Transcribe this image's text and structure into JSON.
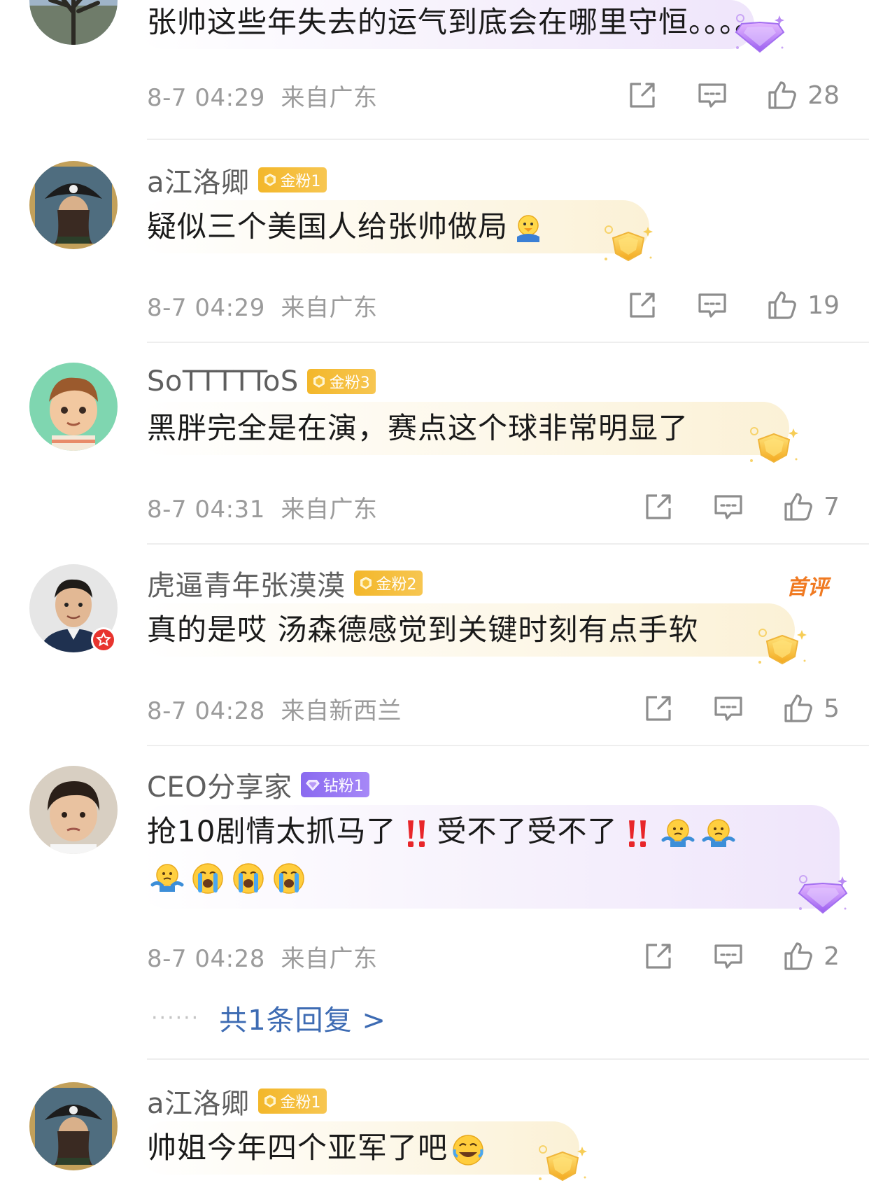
{
  "comments": [
    {
      "username": "",
      "badge": "",
      "lines": [
        "张帅这些年失去的运气到底会在哪里守恒。。。。"
      ],
      "time": "8-7 04:29",
      "location": "来自广东",
      "likes": "28"
    },
    {
      "username": "a江洛卿",
      "badge": "金粉1",
      "lines": [
        "疑似三个美国人给张帅做局"
      ],
      "time": "8-7 04:29",
      "location": "来自广东",
      "likes": "19"
    },
    {
      "username": "SoTTTTToS",
      "badge": "金粉3",
      "lines": [
        "黑胖完全是在演，赛点这个球非常明显了"
      ],
      "time": "8-7 04:31",
      "location": "来自广东",
      "likes": "7"
    },
    {
      "username": "虎逼青年张漠漠",
      "badge": "金粉2",
      "first_comment_tag": "首评",
      "lines": [
        "真的是哎 汤森德感觉到关键时刻有点手软"
      ],
      "time": "8-7 04:28",
      "location": "来自新西兰",
      "likes": "5"
    },
    {
      "username": "CEO分享家",
      "badge": "钻粉1",
      "lines_parts": [
        "抢10剧情太抓马了",
        "受不了受不了"
      ],
      "time": "8-7 04:28",
      "location": "来自广东",
      "likes": "2",
      "replies_label": "共1条回复 >"
    },
    {
      "username": "a江洛卿",
      "badge": "金粉1",
      "lines": [
        "帅姐今年四个亚军了吧"
      ]
    }
  ],
  "icons": {
    "share": "share-icon",
    "reply": "comment-icon",
    "like": "thumbs-up-icon"
  },
  "colors": {
    "gold_badge": "#f3b72a",
    "diamond_badge": "#8a6af0",
    "reply_link": "#3d6bb3",
    "first_comment": "#f07a22",
    "meta_text": "#9b9b9b"
  }
}
